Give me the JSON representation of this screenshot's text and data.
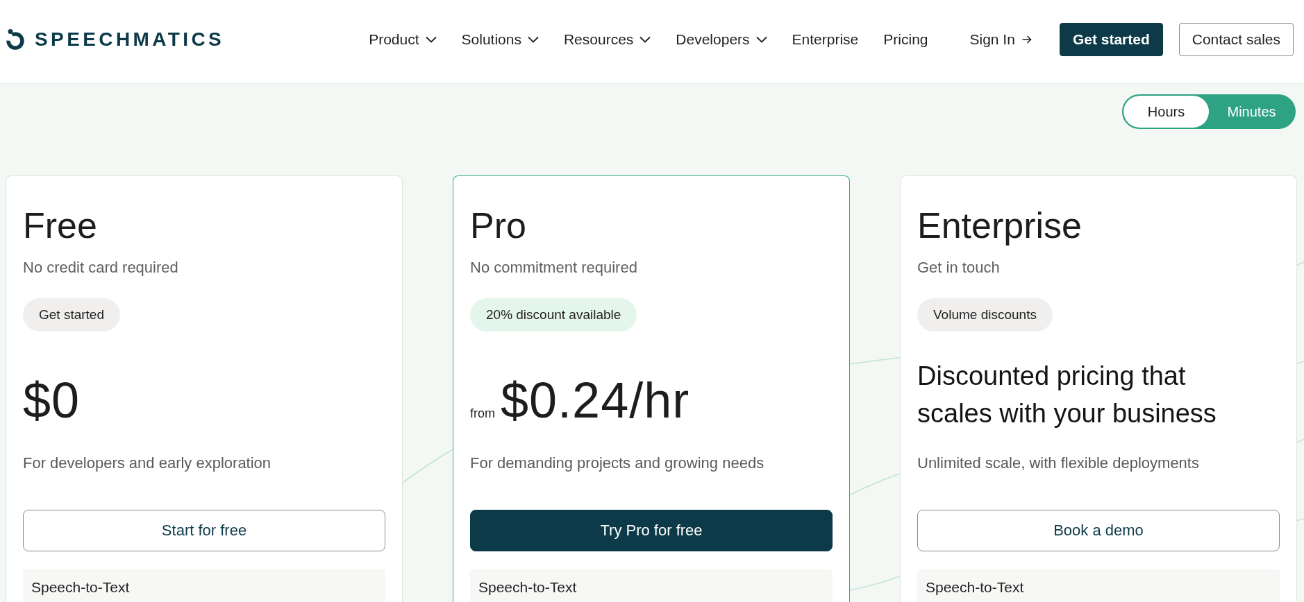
{
  "header": {
    "logo": {
      "text": "SPEECHMATICS"
    },
    "nav": [
      {
        "label": "Product",
        "kind": "menu"
      },
      {
        "label": "Solutions",
        "kind": "menu"
      },
      {
        "label": "Resources",
        "kind": "menu"
      },
      {
        "label": "Developers",
        "kind": "menu"
      },
      {
        "label": "Enterprise",
        "kind": "link"
      },
      {
        "label": "Pricing",
        "kind": "link"
      }
    ],
    "sign_in": {
      "label": "Sign In"
    },
    "buttons": [
      {
        "label": "Get started",
        "kind": "primary"
      },
      {
        "label": "Contact sales",
        "kind": "outline"
      }
    ]
  },
  "unit_toggle": {
    "options": [
      {
        "label": "Hours",
        "selected": true
      },
      {
        "label": "Minutes",
        "selected": false
      }
    ]
  },
  "plans": [
    {
      "name": "Free",
      "subtitle": "No credit card required",
      "highlighted": false,
      "badge": {
        "label": "Get started",
        "kind": "neutral"
      },
      "price": {
        "kind": "amount",
        "amount": "$0"
      },
      "description": "For developers and early exploration",
      "cta": {
        "label": "Start for free",
        "kind": "outline"
      },
      "features": [
        {
          "label": "Speech-to-Text"
        }
      ]
    },
    {
      "name": "Pro",
      "subtitle": "No commitment required",
      "highlighted": true,
      "badge": {
        "label": "20% discount available",
        "kind": "promo"
      },
      "price": {
        "kind": "amount",
        "prefix": "from",
        "amount": "$0.24/hr"
      },
      "description": "For demanding projects and growing needs",
      "cta": {
        "label": "Try Pro for free",
        "kind": "primary"
      },
      "features": [
        {
          "label": "Speech-to-Text"
        }
      ]
    },
    {
      "name": "Enterprise",
      "subtitle": "Get in touch",
      "highlighted": false,
      "badge": {
        "label": "Volume discounts",
        "kind": "neutral"
      },
      "price": {
        "kind": "headline",
        "text": "Discounted pricing that scales with your business"
      },
      "description": "Unlimited scale, with flexible deployments",
      "cta": {
        "label": "Book a demo",
        "kind": "outline"
      },
      "features": [
        {
          "label": "Speech-to-Text"
        }
      ]
    }
  ]
}
